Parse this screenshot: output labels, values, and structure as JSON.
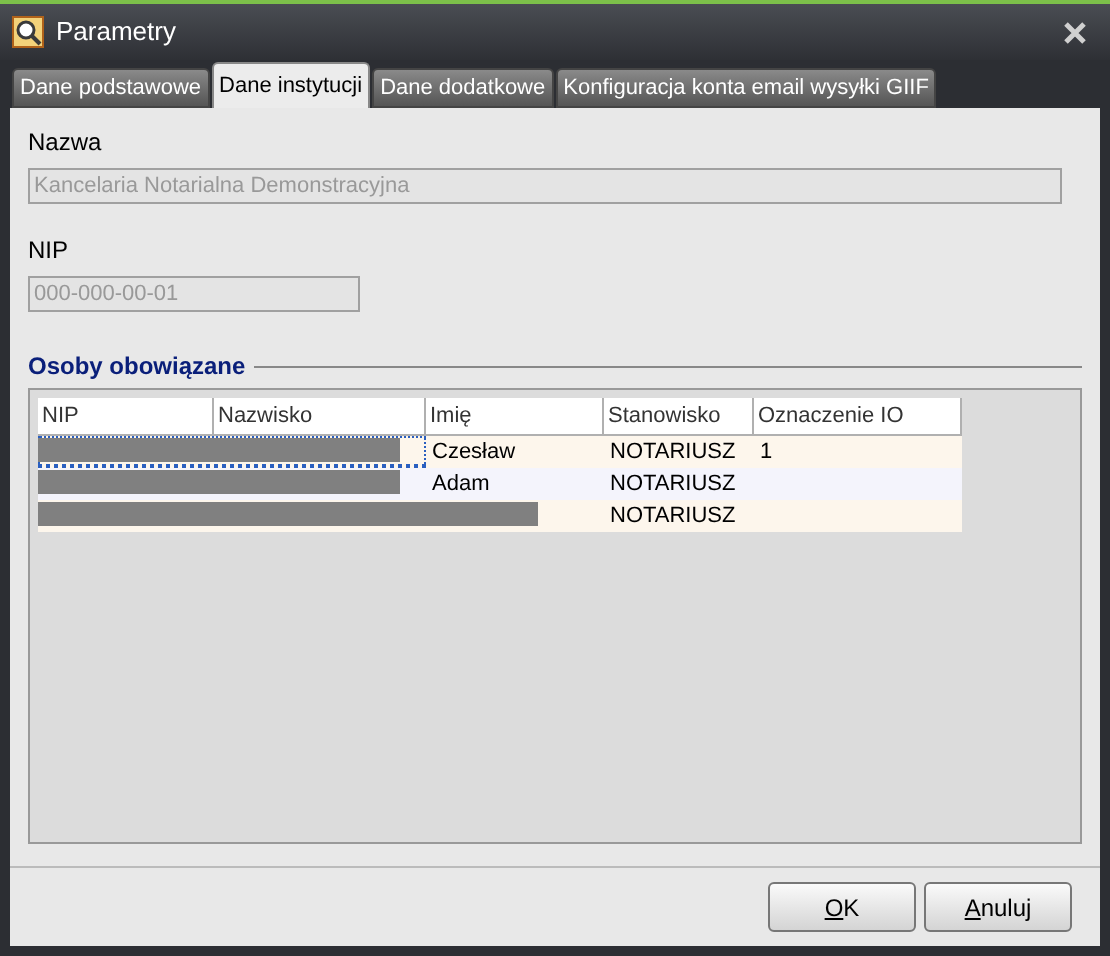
{
  "window": {
    "title": "Parametry"
  },
  "tabs": [
    {
      "label": "Dane podstawowe",
      "selected": false
    },
    {
      "label": "Dane instytucji",
      "selected": true
    },
    {
      "label": "Dane dodatkowe",
      "selected": false
    },
    {
      "label": "Konfiguracja konta email wysyłki GIIF",
      "selected": false
    }
  ],
  "fields": [
    {
      "label": "Nazwa",
      "value": "Kancelaria Notarialna Demonstracyjna",
      "disabled": true,
      "kind": "wide"
    },
    {
      "label": "NIP",
      "value": "000-000-00-01",
      "disabled": true,
      "kind": "narrow"
    }
  ],
  "group": {
    "title": "Osoby obowiązane"
  },
  "table": {
    "columns": [
      "NIP",
      "Nazwisko",
      "Imię",
      "Stanowisko",
      "Oznaczenie IO"
    ],
    "rows": [
      {
        "kind": "short_redaction",
        "selected": true,
        "cells": [
          "",
          "",
          "Czesław",
          "NOTARIUSZ",
          "1"
        ]
      },
      {
        "kind": "short_redaction",
        "selected": false,
        "cells": [
          "",
          "",
          "Adam",
          "NOTARIUSZ",
          ""
        ]
      },
      {
        "kind": "long_redaction",
        "selected": false,
        "cells": [
          "",
          "",
          "",
          "NOTARIUSZ",
          ""
        ]
      }
    ]
  },
  "buttons": [
    {
      "label": "OK"
    },
    {
      "label": "Anuluj"
    }
  ]
}
